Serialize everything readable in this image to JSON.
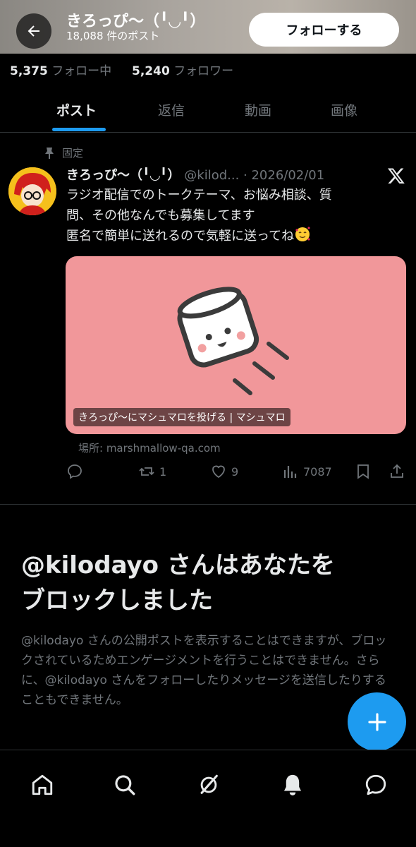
{
  "header": {
    "name": "きろっぴ〜（╹◡╹）",
    "post_count": "18,088 件のポスト",
    "follow_label": "フォローする"
  },
  "stats": {
    "following_count": "5,375",
    "following_label": "フォロー中",
    "followers_count": "5,240",
    "followers_label": "フォロワー"
  },
  "tabs": [
    {
      "label": "ポスト",
      "active": true
    },
    {
      "label": "返信",
      "active": false
    },
    {
      "label": "動画",
      "active": false
    },
    {
      "label": "画像",
      "active": false
    }
  ],
  "post": {
    "pinned_label": "固定",
    "author_name": "きろっぴ〜（╹◡╹）",
    "meta": "@kilod... · 2026/02/01",
    "lines": [
      "ラジオ配信でのトークテーマ、お悩み相談、質",
      "問、その他なんでも募集してます",
      "匿名で簡単に送れるので気軽に送ってね"
    ],
    "card_title": "きろっぴ〜にマシュマロを投げる | マシュマロ",
    "card_domain": "場所: marshmallow-qa.com",
    "card_bg": "#f1979a",
    "reposts": "1",
    "likes": "9",
    "views": "7087"
  },
  "blocked": {
    "title_line1": "@kilodayo さんはあなたを",
    "title_line2": "ブロックしました",
    "text": "@kilodayo さんの公開ポストを表示することはできますが、ブロックされているためエンゲージメントを行うことはできません。さらに、@kilodayo さんをフォローしたりメッセージを送信したりすることもできません。"
  },
  "colors": {
    "accent": "#1d9bf0",
    "muted": "#71767b",
    "text": "#e7e9ea"
  },
  "nav": [
    "home-icon",
    "search-icon",
    "grok-icon",
    "notifications-icon",
    "messages-icon"
  ]
}
